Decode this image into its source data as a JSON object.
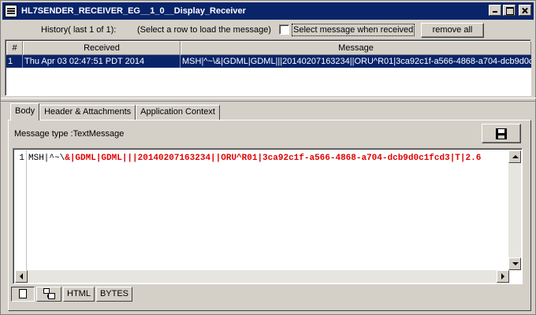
{
  "window": {
    "title": "HL7SENDER_RECEIVER_EG__1_0__Display_Receiver",
    "icon": "list-icon"
  },
  "history": {
    "label": "History( last 1 of 1):",
    "hint": "(Select a row to load the message)",
    "checkbox_label": "Select message when received",
    "checkbox_checked": false,
    "remove_all_label": "remove all"
  },
  "table": {
    "columns": [
      "#",
      "Received",
      "Message"
    ],
    "rows": [
      {
        "num": "1",
        "received": "Thu Apr 03 02:47:51 PDT 2014",
        "message": "MSH|^~\\&|GDML|GDML|||20140207163234||ORU^R01|3ca92c1f-a566-4868-a704-dcb9d0c1"
      }
    ],
    "selection_color": "#0a246a"
  },
  "tabs": [
    {
      "label": "Body",
      "active": true
    },
    {
      "label": "Header & Attachments",
      "active": false
    },
    {
      "label": "Application Context",
      "active": false
    }
  ],
  "body": {
    "message_type": "Message type :TextMessage",
    "save_icon": "floppy-disk-icon",
    "line_number": "1",
    "code_plain": "MSH|^~\\",
    "code_highlight": "&|GDML|GDML|||20140207163234||ORU^R01|3ca92c1f-a566-4868-a704-dcb9d0c1fcd3|T|2.6",
    "highlight_color": "#e00000"
  },
  "view_buttons": [
    {
      "icon": "document-icon",
      "active": true
    },
    {
      "icon": "tree-view-icon",
      "active": false
    },
    {
      "label": "HTML",
      "active": false
    },
    {
      "label": "BYTES",
      "active": false
    }
  ]
}
